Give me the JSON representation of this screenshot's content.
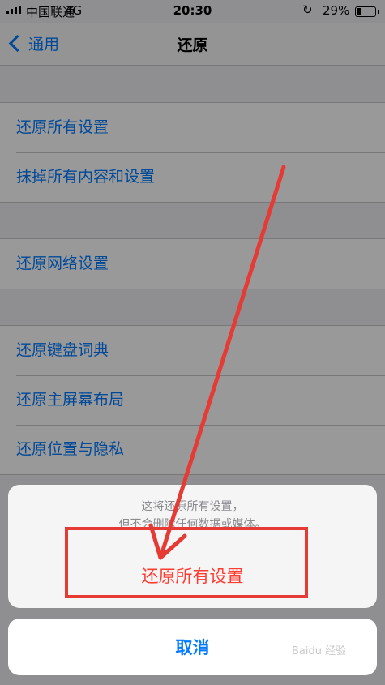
{
  "status_bar": {
    "carrier": "中国联通",
    "network": "4G",
    "time": "20:30",
    "lock_icon": "↻",
    "battery_percent": "29%"
  },
  "nav": {
    "back_label": "通用",
    "title": "还原"
  },
  "groups": [
    {
      "items": [
        "还原所有设置",
        "抹掉所有内容和设置"
      ]
    },
    {
      "items": [
        "还原网络设置"
      ]
    },
    {
      "items": [
        "还原键盘词典",
        "还原主屏幕布局",
        "还原位置与隐私"
      ]
    }
  ],
  "action_sheet": {
    "message_line1": "这将还原所有设置，",
    "message_line2": "但不会删除任何数据或媒体。",
    "destructive_label": "还原所有设置",
    "cancel_label": "取消"
  },
  "colors": {
    "accent": "#007aff",
    "destructive": "#ff3b30",
    "annotation": "#e63a35"
  },
  "watermark": "Baidu 经验"
}
